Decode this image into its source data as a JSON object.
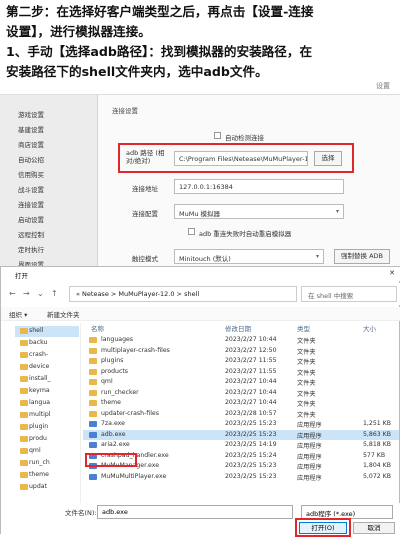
{
  "instructions": {
    "line1": "第二步：在选择好客户端类型之后，再点击【设置-连接",
    "line2": "设置】，进行模拟器连接。",
    "line3": "1、手动【选择adb路径】：找到模拟器的安装路径，在",
    "line4": "安装路径下的shell文件夹内，选中adb文件。"
  },
  "settings": {
    "close_label": "设置",
    "sidebar": [
      "游戏设置",
      "基建设置",
      "商店设置",
      "自动公招",
      "信用购买",
      "战斗设置",
      "连接设置",
      "启动设置",
      "远程控制",
      "定时执行",
      "界面设置",
      "其他设置"
    ],
    "section_title": "连接设置",
    "auto_detect_label": "自动检测连接",
    "adb_path_label": "adb 路径 (相对/绝对)",
    "adb_path_value": "C:\\Program Files\\Netease\\MuMuPlayer-1",
    "select_button": "选择",
    "address_label": "连接地址",
    "address_value": "127.0.0.1:16384",
    "config_label": "连接配置",
    "config_value": "MuMu 模拟器",
    "reconnect_label": "adb 重连失败时自动重启模拟器",
    "touch_label": "触控模式",
    "touch_value": "Minitouch (默认)",
    "force_replace_button": "强制替换 ADB"
  },
  "dialog": {
    "title": "打开",
    "breadcrumb": "« Netease > MuMuPlayer-12.0 > shell",
    "search_placeholder": "在 shell 中搜索",
    "toolbar": {
      "organize": "组织 ▾",
      "new_folder": "新建文件夹"
    },
    "tree": [
      "shell",
      "backu",
      "crash-",
      "device",
      "install_",
      "keyma",
      "langua",
      "multipl",
      "plugin",
      "produ",
      "qml",
      "run_ch",
      "theme",
      "updat"
    ],
    "columns": {
      "name": "名称",
      "date": "修改日期",
      "type": "类型",
      "size": "大小"
    },
    "files": [
      {
        "name": "languages",
        "date": "2023/2/27 10:44",
        "type": "文件夹",
        "size": "",
        "kind": "folder"
      },
      {
        "name": "multiplayer-crash-files",
        "date": "2023/2/27 12:50",
        "type": "文件夹",
        "size": "",
        "kind": "folder"
      },
      {
        "name": "plugins",
        "date": "2023/2/27 11:55",
        "type": "文件夹",
        "size": "",
        "kind": "folder"
      },
      {
        "name": "products",
        "date": "2023/2/27 11:55",
        "type": "文件夹",
        "size": "",
        "kind": "folder"
      },
      {
        "name": "qml",
        "date": "2023/2/27 10:44",
        "type": "文件夹",
        "size": "",
        "kind": "folder"
      },
      {
        "name": "run_checker",
        "date": "2023/2/27 10:44",
        "type": "文件夹",
        "size": "",
        "kind": "folder"
      },
      {
        "name": "theme",
        "date": "2023/2/27 10:44",
        "type": "文件夹",
        "size": "",
        "kind": "folder"
      },
      {
        "name": "updater-crash-files",
        "date": "2023/2/28 10:57",
        "type": "文件夹",
        "size": "",
        "kind": "folder"
      },
      {
        "name": "7za.exe",
        "date": "2023/2/25 15:23",
        "type": "应用程序",
        "size": "1,251 KB",
        "kind": "exe"
      },
      {
        "name": "adb.exe",
        "date": "2023/2/25 15:23",
        "type": "应用程序",
        "size": "5,863 KB",
        "kind": "exe"
      },
      {
        "name": "aria2.exe",
        "date": "2023/2/25 14:19",
        "type": "应用程序",
        "size": "5,818 KB",
        "kind": "exe"
      },
      {
        "name": "crashpad_handler.exe",
        "date": "2023/2/25 15:24",
        "type": "应用程序",
        "size": "577 KB",
        "kind": "exe"
      },
      {
        "name": "MuMuManager.exe",
        "date": "2023/2/25 15:23",
        "type": "应用程序",
        "size": "1,804 KB",
        "kind": "exe"
      },
      {
        "name": "MuMuMultiPlayer.exe",
        "date": "2023/2/25 15:23",
        "type": "应用程序",
        "size": "5,072 KB",
        "kind": "exe"
      }
    ],
    "filename_label": "文件名(N):",
    "filename_value": "adb.exe",
    "filetype_value": "adb程序 (*.exe)",
    "open_button": "打开(O)",
    "cancel_button": "取消"
  }
}
